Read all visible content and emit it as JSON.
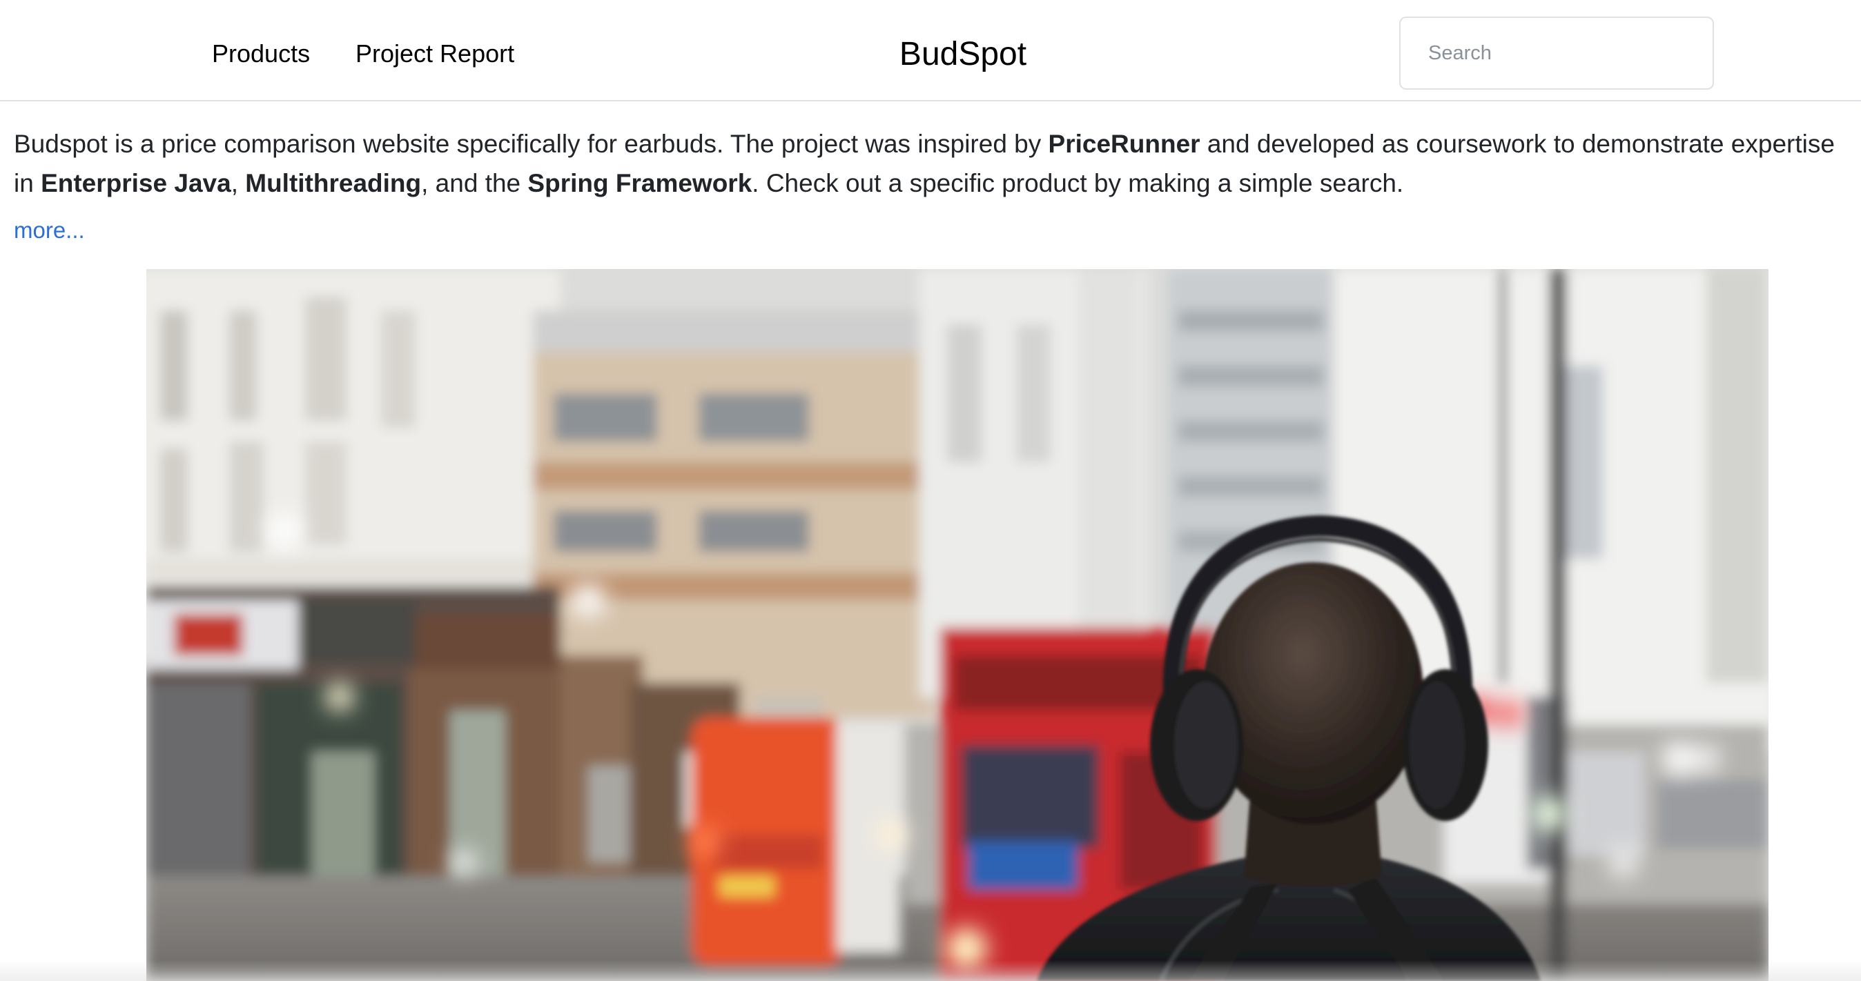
{
  "nav": {
    "products": "Products",
    "project_report": "Project Report",
    "brand": "BudSpot",
    "search_placeholder": "Search"
  },
  "intro": {
    "t1": "Budspot is a price comparison website specifically for earbuds. The project was inspired by ",
    "b1": "PriceRunner",
    "t2": " and developed as coursework to demonstrate expertise in ",
    "b2": "Enterprise Java",
    "t3": ", ",
    "b3": "Multithreading",
    "t4": ", and the ",
    "b4": "Spring Framework",
    "t5": ". Check out a specific product by making a simple search."
  },
  "more_link": "more...",
  "colors": {
    "link": "#2b6fd6",
    "text": "#212529",
    "border": "#dee2e6"
  }
}
